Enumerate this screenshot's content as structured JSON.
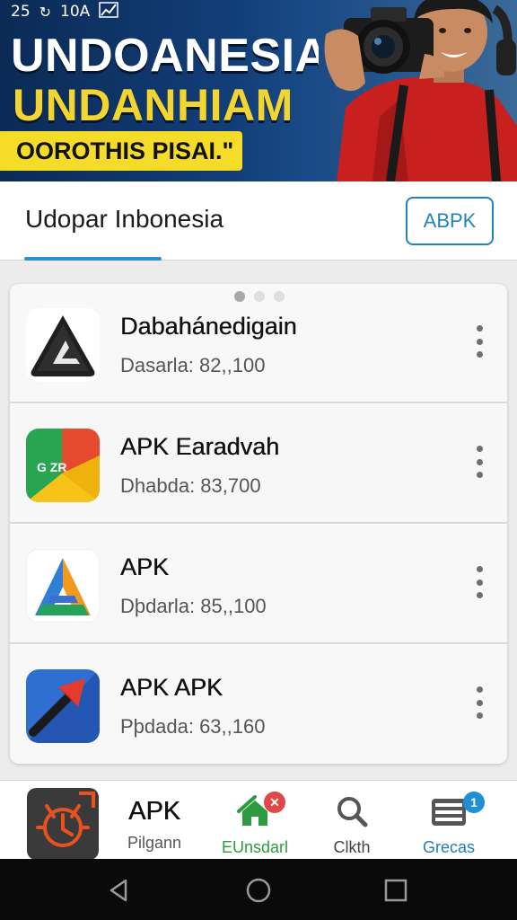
{
  "status_bar": {
    "time": "25",
    "network": "10A"
  },
  "banner": {
    "line1": "UNDOANESIA",
    "line2": "UNDANHIAM",
    "line3": "OOROTHIS PISAI.\""
  },
  "header": {
    "title": "Udopar Inbonesia",
    "button_label": "ABPK"
  },
  "apps": [
    {
      "name": "Dabahánedigain",
      "detail": "Dasarla: 82,,100",
      "icon": "triangle-logo-icon"
    },
    {
      "name": "APK Earadvah",
      "detail": "Dhabda: 83,700",
      "icon": "colorful-folder-icon",
      "icon_text": "G ZR"
    },
    {
      "name": "APK",
      "detail": "Dþdarla: 85,,100",
      "icon": "a-logo-icon"
    },
    {
      "name": "APK APK",
      "detail": "Pþdada: 63,,160",
      "icon": "arrow-logo-icon"
    }
  ],
  "bottom_nav": {
    "app": {
      "title": "APK",
      "label": "Pilgann"
    },
    "items": [
      {
        "label": "EUnsdarl",
        "icon": "home-icon",
        "badge_icon": "close-badge-icon",
        "color": "#2e9a3e"
      },
      {
        "label": "Clkth",
        "icon": "search-icon",
        "color": "#444444"
      },
      {
        "label": "Grecas",
        "icon": "list-icon",
        "badge": "1",
        "color": "#1f7fb6"
      }
    ]
  },
  "colors": {
    "accent": "#2d8fcb",
    "banner_bg": "#123e78",
    "banner_yellow": "#f3d531"
  }
}
